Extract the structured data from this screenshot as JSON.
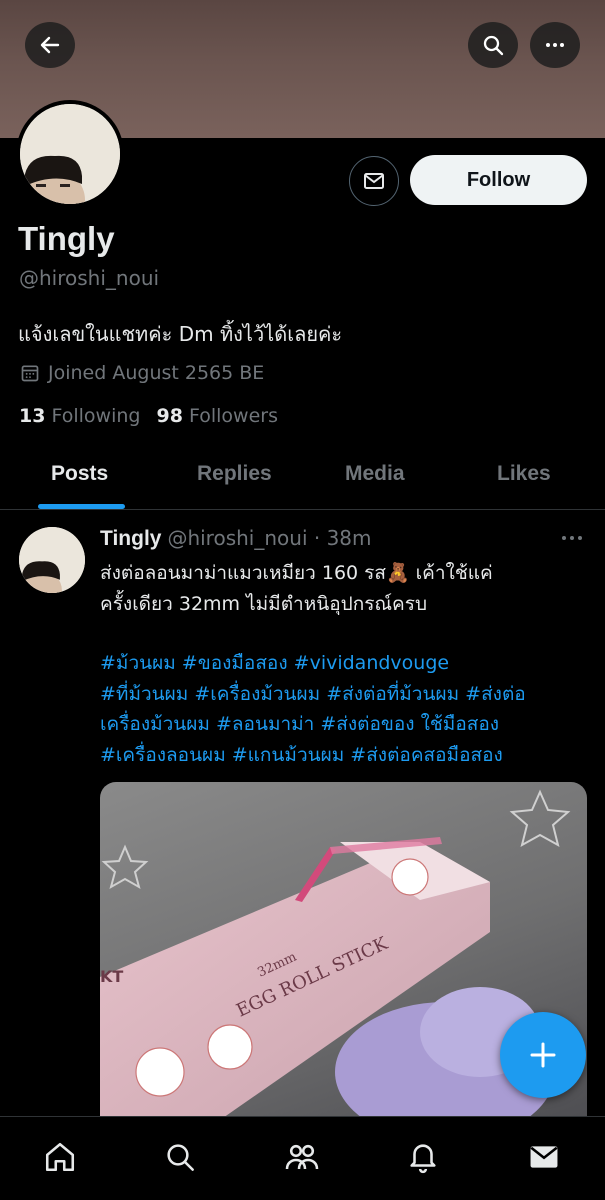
{
  "profile": {
    "name": "Tingly",
    "handle": "@hiroshi_noui",
    "bio": "แจ้งเลขในแชทค่ะ Dm ทิ้งไว้ได้เลยค่ะ",
    "joined": "Joined August 2565 BE",
    "following_count": "13",
    "following_label": "Following",
    "followers_count": "98",
    "followers_label": "Followers"
  },
  "actions": {
    "follow_label": "Follow"
  },
  "tabs": [
    {
      "label": "Posts",
      "active": true
    },
    {
      "label": "Replies",
      "active": false
    },
    {
      "label": "Media",
      "active": false
    },
    {
      "label": "Likes",
      "active": false
    }
  ],
  "post": {
    "author": "Tingly",
    "handle_time": "@hiroshi_noui · 38m",
    "text_line1": "ส่งต่อลอนมาม่าแมวเหมียว 160 รส🧸 เค้าใช้แค่",
    "text_line2": "ครั้งเดียว 32mm ไม่มีตำหนิอุปกรณ์ครบ",
    "tags_line1": "#ม้วนผม #ของมือสอง #vividandvouge",
    "tags_line2": "#ที่ม้วนผม #เครื่องม้วนผม #ส่งต่อที่ม้วนผม #ส่งต่อ",
    "tags_line3": "เครื่องม้วนผม #ลอนมาม่า #ส่งต่อของ ใช้มือสอง",
    "tags_line4": "#เครื่องลอนผม #แกนม้วนผม #ส่งต่อคสอมือสอง",
    "image_text_size": "32mm",
    "image_text_product": "EGG ROLL STICK",
    "image_text_side": "KT"
  },
  "icons": {
    "back": "arrow-left-icon",
    "search": "search-icon",
    "more": "more-horizontal-icon",
    "message": "envelope-icon",
    "calendar": "calendar-icon",
    "compose": "plus-icon",
    "nav": [
      "home-icon",
      "search-icon",
      "communities-icon",
      "bell-icon",
      "mail-icon"
    ]
  },
  "colors": {
    "accent": "#1d9bf0",
    "muted": "#71767b",
    "text": "#e7e9ea",
    "background": "#000000"
  }
}
